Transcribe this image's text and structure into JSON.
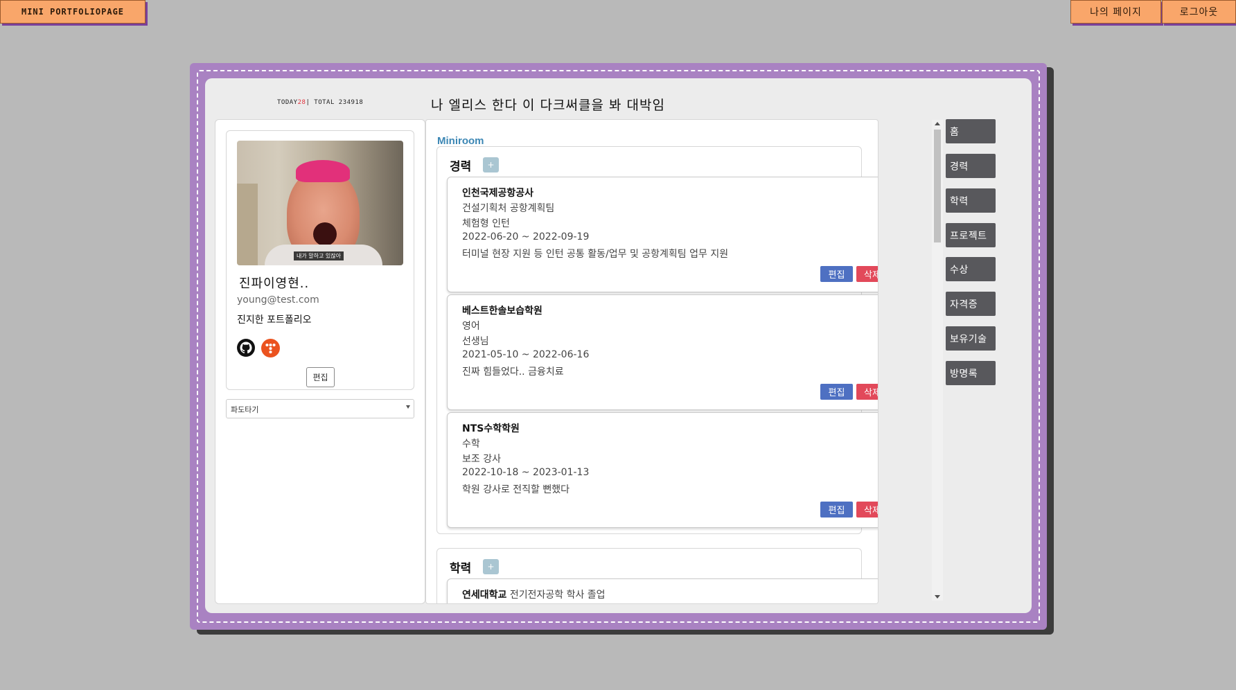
{
  "header": {
    "logo": "MINI PORTFOLIOPAGE",
    "my_page": "나의 페이지",
    "logout": "로그아웃"
  },
  "counter": {
    "today_label": "TODAY",
    "today_value": "28",
    "separator": "|",
    "total_label": "TOTAL",
    "total_value": "234918"
  },
  "page_title": "나 엘리스 한다 이 다크써클을 봐 대박임",
  "profile": {
    "photo_caption": "내가 말하고 있잖아",
    "name": "진파이영현..",
    "email": "young@test.com",
    "description": "진지한 포트폴리오",
    "edit_label": "편집",
    "icons": [
      "github-icon",
      "tistory-icon"
    ]
  },
  "bgm": {
    "selected": "파도타기"
  },
  "main": {
    "section_label": "Miniroom",
    "career": {
      "title": "경력",
      "add_label": "+",
      "items": [
        {
          "org": "인천국제공항공사",
          "dept": "건설기획처 공항계획팀",
          "role": "체험형 인턴",
          "period": "2022-06-20 ~ 2022-09-19",
          "desc": "터미널 현장 지원 등 인턴 공통 활동/업무 및 공항계획팀 업무 지원"
        },
        {
          "org": "베스트한솔보습학원",
          "dept": "영어",
          "role": "선생님",
          "period": "2021-05-10 ~ 2022-06-16",
          "desc": "진짜 힘들었다.. 금융치료"
        },
        {
          "org": "NTS수학학원",
          "dept": "수학",
          "role": "보조 강사",
          "period": "2022-10-18 ~ 2023-01-13",
          "desc": "학원 강사로 전직할 뻔했다"
        }
      ],
      "edit_label": "편집",
      "delete_label": "삭제"
    },
    "education": {
      "title": "학력",
      "add_label": "+",
      "items": [
        {
          "school": "연세대학교",
          "detail": "전기전자공학 학사 졸업"
        }
      ]
    }
  },
  "nav": {
    "items": [
      "홈",
      "경력",
      "학력",
      "프로젝트",
      "수상",
      "자격증",
      "보유기술",
      "방명록"
    ]
  },
  "colors": {
    "frame": "#a982c2",
    "header_button": "#f9a66a",
    "edit_button": "#4e70c2",
    "delete_button": "#e2495a",
    "nav_tab": "#58585c",
    "section_label": "#3b86b4"
  }
}
